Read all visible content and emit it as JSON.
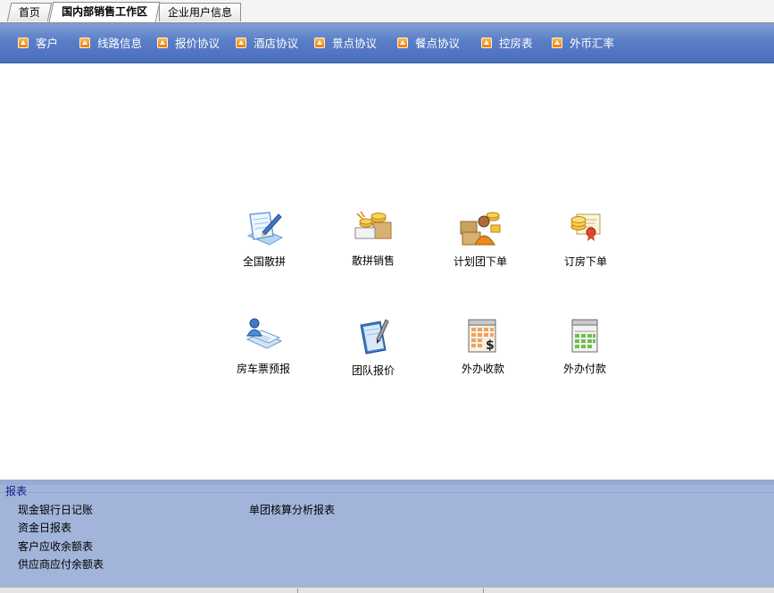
{
  "tabs": [
    {
      "label": "首页",
      "active": false
    },
    {
      "label": "国内部销售工作区",
      "active": true
    },
    {
      "label": "企业用户信息",
      "active": false
    }
  ],
  "menu": [
    {
      "label": "客户",
      "icon": "orange-arrow-icon"
    },
    {
      "label": "线路信息",
      "icon": "orange-arrow-icon"
    },
    {
      "label": "报价协议",
      "icon": "orange-arrow-icon"
    },
    {
      "label": "酒店协议",
      "icon": "orange-arrow-icon"
    },
    {
      "label": "景点协议",
      "icon": "orange-arrow-icon"
    },
    {
      "label": "餐点协议",
      "icon": "orange-arrow-icon"
    },
    {
      "label": "控房表",
      "icon": "orange-arrow-icon"
    },
    {
      "label": "外币汇率",
      "icon": "orange-arrow-icon"
    }
  ],
  "tiles": [
    {
      "label": "全国散拼",
      "icon": "notepad-pen-icon"
    },
    {
      "label": "散拼销售",
      "icon": "coins-boxes-icon"
    },
    {
      "label": "计划团下单",
      "icon": "person-boxes-icon"
    },
    {
      "label": "订房下单",
      "icon": "certificate-coins-icon"
    },
    {
      "label": "房车票预报",
      "icon": "user-document-icon"
    },
    {
      "label": "团队报价",
      "icon": "book-pen-icon"
    },
    {
      "label": "外办收款",
      "icon": "calendar-dollar-icon"
    },
    {
      "label": "外办付款",
      "icon": "calendar-green-icon"
    }
  ],
  "reports": {
    "title": "报表",
    "col1": [
      "现金银行日记账",
      "资金日报表",
      "客户应收余额表",
      "供应商应付余额表"
    ],
    "col2": [
      "单团核算分析报表"
    ]
  },
  "colors": {
    "menu_bar": "#5a7ec6",
    "report_panel": "#a2b4d9",
    "report_title": "#1a1a8c"
  }
}
